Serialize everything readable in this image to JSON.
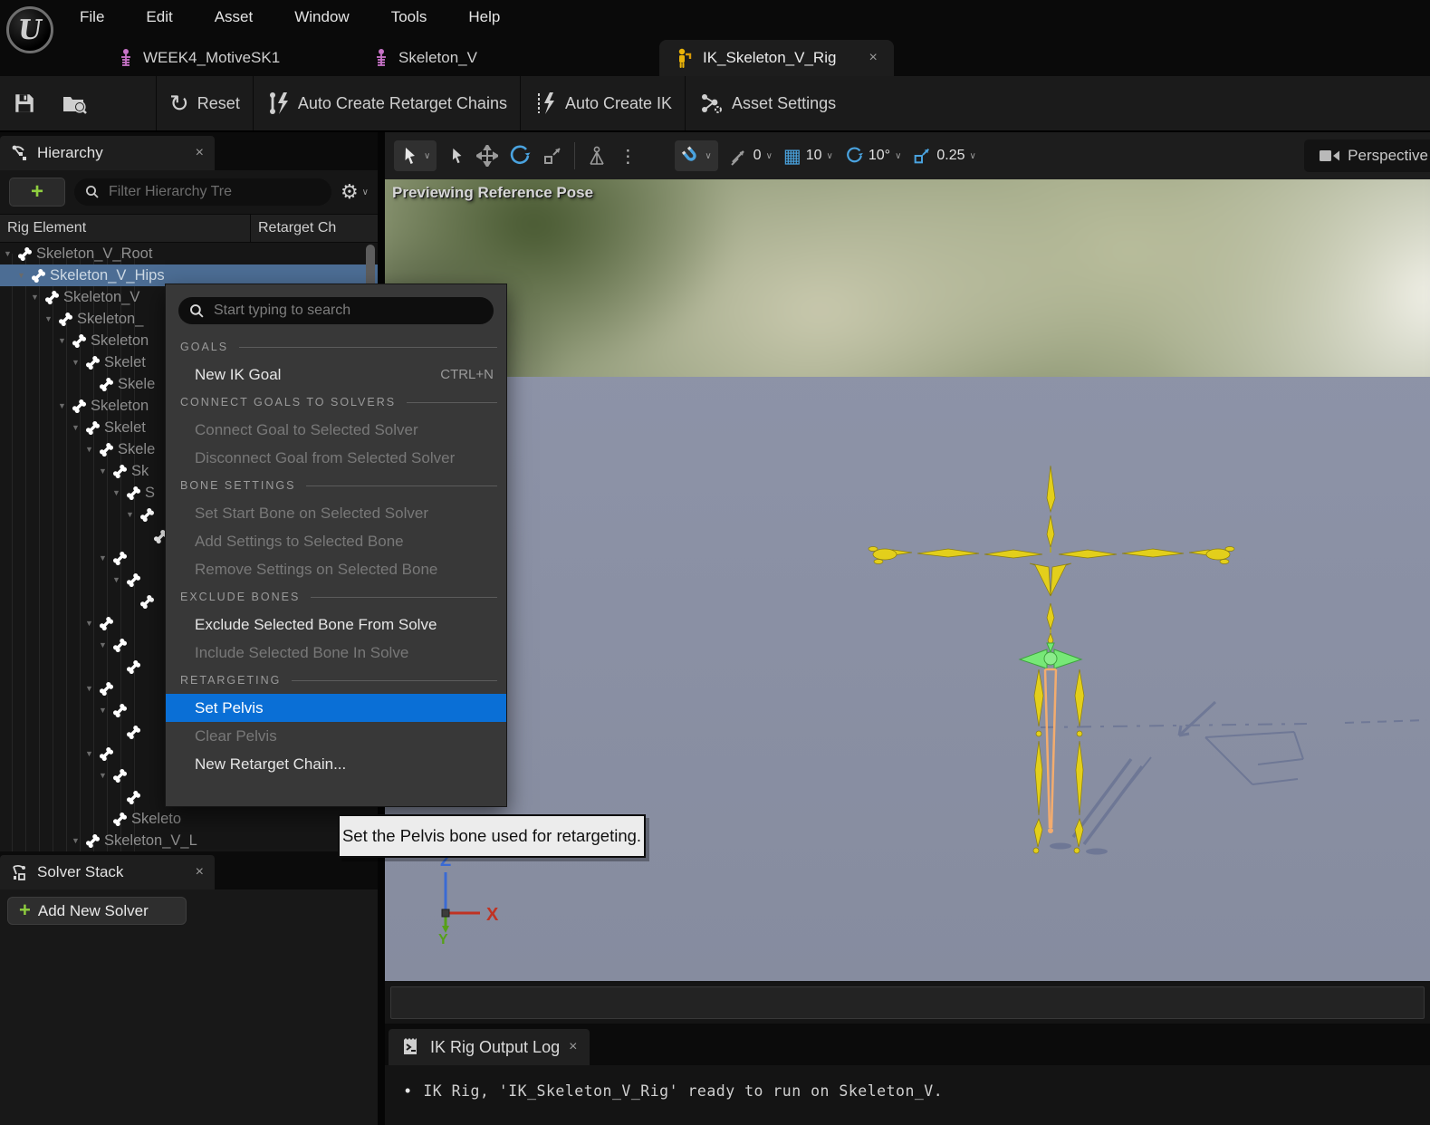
{
  "menu_bar": {
    "items": [
      "File",
      "Edit",
      "Asset",
      "Window",
      "Tools",
      "Help"
    ]
  },
  "tabs": [
    {
      "label": "WEEK4_MotiveSK1",
      "icon": "skeleton-asset-icon",
      "active": false
    },
    {
      "label": "Skeleton_V",
      "icon": "skeleton-asset-icon",
      "active": false
    },
    {
      "label": "IK_Skeleton_V_Rig",
      "icon": "ik-rig-icon",
      "active": true
    }
  ],
  "toolbar": {
    "reset_label": "Reset",
    "auto_chains_label": "Auto Create Retarget Chains",
    "auto_ik_label": "Auto Create IK",
    "asset_settings_label": "Asset Settings"
  },
  "hierarchy": {
    "title": "Hierarchy",
    "filter_placeholder": "Filter Hierarchy Tre",
    "columns": {
      "col1": "Rig Element",
      "col2": "Retarget Ch"
    },
    "rows": [
      {
        "label": "Skeleton_V_Root",
        "indent": 0,
        "selected": false
      },
      {
        "label": "Skeleton_V_Hips",
        "indent": 1,
        "selected": true
      },
      {
        "label": "Skeleton_V",
        "indent": 2
      },
      {
        "label": "Skeleton_",
        "indent": 3
      },
      {
        "label": "Skeleton",
        "indent": 4
      },
      {
        "label": "Skelet",
        "indent": 5
      },
      {
        "label": "Skele",
        "indent": 6,
        "leaf": true
      },
      {
        "label": "Skeleton",
        "indent": 4
      },
      {
        "label": "Skelet",
        "indent": 5
      },
      {
        "label": "Skele",
        "indent": 6
      },
      {
        "label": "Sk",
        "indent": 7
      },
      {
        "label": "S",
        "indent": 8
      },
      {
        "label": "",
        "indent": 9
      },
      {
        "label": "",
        "indent": 10,
        "leaf": true
      },
      {
        "label": "",
        "indent": 7
      },
      {
        "label": "",
        "indent": 8
      },
      {
        "label": "",
        "indent": 9,
        "leaf": true
      },
      {
        "label": "",
        "indent": 6
      },
      {
        "label": "",
        "indent": 7
      },
      {
        "label": "",
        "indent": 8,
        "leaf": true
      },
      {
        "label": "",
        "indent": 6
      },
      {
        "label": "",
        "indent": 7
      },
      {
        "label": "",
        "indent": 8,
        "leaf": true
      },
      {
        "label": "",
        "indent": 6
      },
      {
        "label": "",
        "indent": 7
      },
      {
        "label": "",
        "indent": 8,
        "leaf": true
      },
      {
        "label": "Skeleto",
        "indent": 7,
        "leaf": true
      },
      {
        "label": "Skeleton_V_L",
        "indent": 5
      }
    ]
  },
  "context_menu": {
    "search_placeholder": "Start typing to search",
    "sections": [
      {
        "header": "GOALS",
        "items": [
          {
            "label": "New IK Goal",
            "shortcut": "CTRL+N",
            "state": "enabled"
          }
        ]
      },
      {
        "header": "CONNECT GOALS TO SOLVERS",
        "items": [
          {
            "label": "Connect Goal to Selected Solver",
            "state": "disabled"
          },
          {
            "label": "Disconnect Goal from Selected Solver",
            "state": "disabled"
          }
        ]
      },
      {
        "header": "BONE SETTINGS",
        "items": [
          {
            "label": "Set Start Bone on Selected Solver",
            "state": "disabled"
          },
          {
            "label": "Add Settings to Selected Bone",
            "state": "disabled"
          },
          {
            "label": "Remove Settings on Selected Bone",
            "state": "disabled"
          }
        ]
      },
      {
        "header": "EXCLUDE BONES",
        "items": [
          {
            "label": "Exclude Selected Bone From Solve",
            "state": "enabled"
          },
          {
            "label": "Include Selected Bone In Solve",
            "state": "disabled"
          }
        ]
      },
      {
        "header": "RETARGETING",
        "items": [
          {
            "label": "Set Pelvis",
            "state": "highlighted"
          },
          {
            "label": "Clear Pelvis",
            "state": "disabled"
          },
          {
            "label": "New Retarget Chain...",
            "state": "enabled"
          }
        ]
      }
    ]
  },
  "tooltip": "Set the Pelvis bone used for retargeting.",
  "viewport": {
    "overlay_label": "Previewing Reference Pose",
    "perspective_label": "Perspective",
    "snap_surface_value": "0",
    "snap_grid_value": "10",
    "snap_rotation_value": "10°",
    "snap_scale_value": "0.25",
    "axis": {
      "x": "X",
      "y": "Y",
      "z": "Z"
    }
  },
  "solver_stack": {
    "title": "Solver Stack",
    "add_button_label": "Add New Solver"
  },
  "output_log": {
    "tab_label": "IK Rig Output Log",
    "lines": [
      "IK Rig, 'IK_Skeleton_V_Rig' ready to run on Skeleton_V."
    ]
  },
  "colors": {
    "selection_blue": "#4C6D94",
    "highlight_blue": "#0A6FD6",
    "viewport_gray": "#8D93A8",
    "bone_yellow": "#E3CF1B",
    "pelvis_green": "#77E877",
    "root_orange": "#F3AC6E",
    "accent_green": "#8FCE3F",
    "tab_icon_pink": "#C873C8",
    "tab_icon_yellow": "#EAB308",
    "tool_blue": "#4AA3DF"
  }
}
